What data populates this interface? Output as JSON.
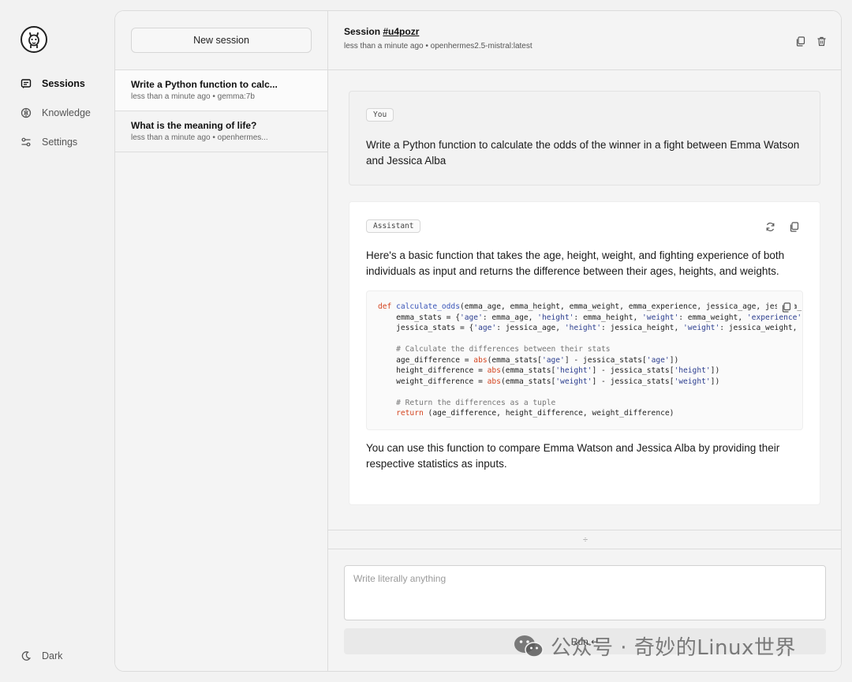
{
  "nav": {
    "items": [
      {
        "label": "Sessions",
        "icon": "chat-icon",
        "active": true
      },
      {
        "label": "Knowledge",
        "icon": "brain-icon",
        "active": false
      },
      {
        "label": "Settings",
        "icon": "sliders-icon",
        "active": false
      }
    ],
    "theme_toggle": "Dark"
  },
  "sessions": {
    "new_label": "New session",
    "items": [
      {
        "title": "Write a Python function to calc...",
        "meta": "less than a minute ago • gemma:7b",
        "active": true
      },
      {
        "title": "What is the meaning of life?",
        "meta": "less than a minute ago • openhermes...",
        "active": false
      }
    ]
  },
  "header": {
    "title_prefix": "Session ",
    "session_id": "#u4pozr",
    "meta": "less than a minute ago • openhermes2.5-mistral:latest"
  },
  "messages": {
    "user": {
      "role": "You",
      "text": "Write a Python function to calculate the odds of the winner in a fight between Emma Watson and Jessica Alba"
    },
    "assistant": {
      "role": "Assistant",
      "intro": "Here's a basic function that takes the age, height, weight, and fighting experience of both individuals as input and returns the difference between their ages, heights, and weights.",
      "outro": "You can use this function to compare Emma Watson and Jessica Alba by providing their respective statistics as inputs."
    }
  },
  "composer": {
    "placeholder": "Write literally anything",
    "run_label": "Run ↵"
  },
  "watermark": "公众号 · 奇妙的Linux世界"
}
